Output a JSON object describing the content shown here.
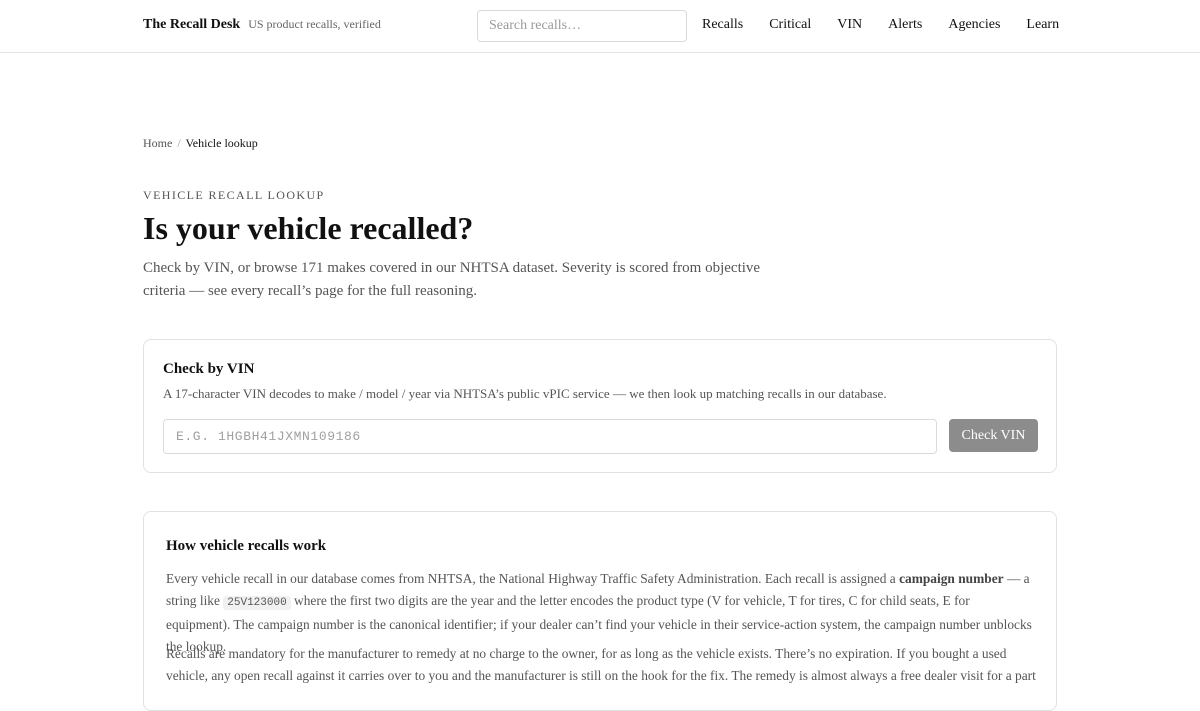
{
  "header": {
    "brand_name": "The Recall Desk",
    "brand_tagline": "US product recalls, verified",
    "search_placeholder": "Search recalls…",
    "nav": [
      "Recalls",
      "Critical",
      "VIN",
      "Alerts",
      "Agencies",
      "Learn"
    ]
  },
  "breadcrumb": {
    "home": "Home",
    "separator": "/",
    "current": "Vehicle lookup"
  },
  "hero": {
    "eyebrow": "VEHICLE RECALL LOOKUP",
    "title": "Is your vehicle recalled?",
    "lede_line1": "Check by VIN, or browse 171 makes covered in our NHTSA dataset. Severity is scored from objective",
    "lede_line2": "criteria — see every recall’s page for the full reasoning."
  },
  "vin_card": {
    "title": "Check by VIN",
    "description": "A 17-character VIN decodes to make / model / year via NHTSA’s public vPIC service — we then look up matching recalls in our database.",
    "input_placeholder": "E.G. 1HGBH41JXMN109186",
    "button_label": "Check VIN"
  },
  "how_card": {
    "title": "How vehicle recalls work",
    "p1_a": "Every vehicle recall in our database comes from NHTSA, the National Highway Traffic Safety Administration. Each recall is assigned a ",
    "p1_strong": "campaign number",
    "p1_b": " — a string like ",
    "p1_code": "25V123000",
    "p1_c": " where the first two digits are the year and the letter encodes the product type (V for vehicle, T for tires, C for child seats, E for equipment). The campaign number is the canonical identifier; if your dealer can’t find your vehicle in their service-action system, the campaign number unblocks the lookup.",
    "p2": "Recalls are mandatory for the manufacturer to remedy at no charge to the owner, for as long as the vehicle exists. There’s no expiration. If you bought a used vehicle, any open recall against it carries over to you and the manufacturer is still on the hook for the fix. The remedy is almost always a free dealer visit for a part"
  }
}
